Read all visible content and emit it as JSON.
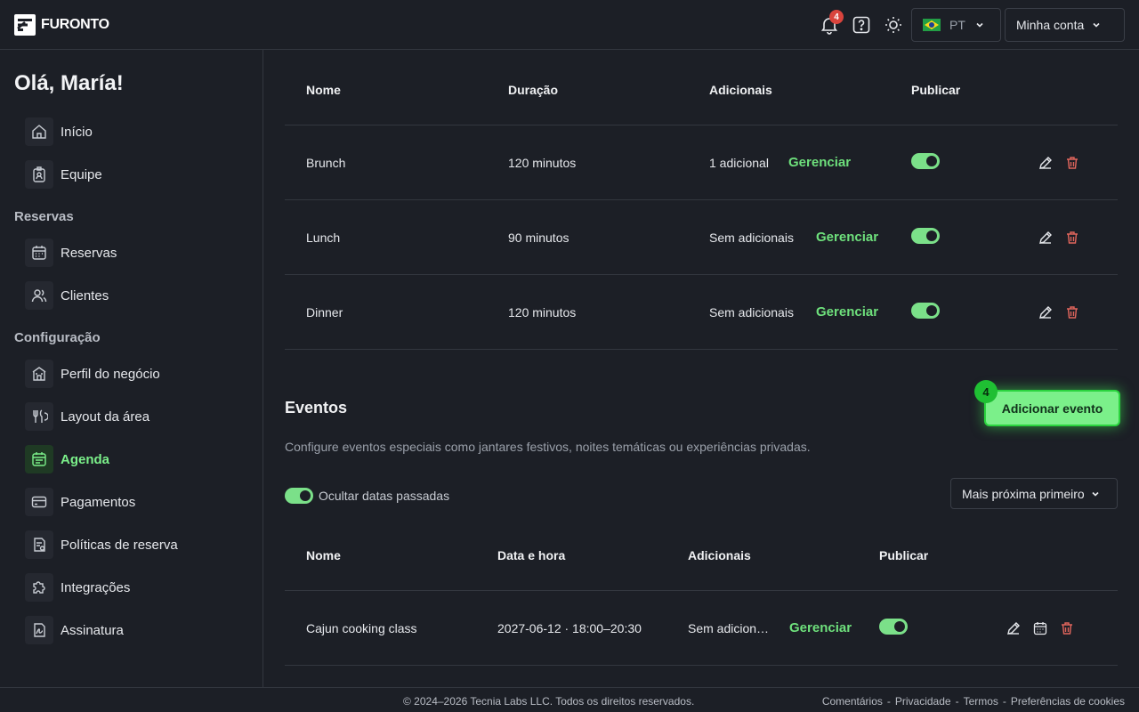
{
  "header": {
    "brand": "FURONTO",
    "notifications_count": "4",
    "language": "PT",
    "account_label": "Minha conta"
  },
  "sidebar": {
    "greeting": "Olá, María!",
    "items_top": [
      {
        "label": "Início",
        "icon": "home-icon"
      },
      {
        "label": "Equipe",
        "icon": "badge-icon"
      }
    ],
    "section_reservas": "Reservas",
    "items_reservas": [
      {
        "label": "Reservas",
        "icon": "calendar-icon"
      },
      {
        "label": "Clientes",
        "icon": "users-icon"
      }
    ],
    "section_config": "Configuração",
    "items_config": [
      {
        "label": "Perfil do negócio",
        "icon": "store-icon"
      },
      {
        "label": "Layout da área",
        "icon": "utensils-icon"
      },
      {
        "label": "Agenda",
        "icon": "schedule-icon",
        "active": true
      },
      {
        "label": "Pagamentos",
        "icon": "card-icon"
      },
      {
        "label": "Políticas de reserva",
        "icon": "policy-icon"
      },
      {
        "label": "Integrações",
        "icon": "puzzle-icon"
      },
      {
        "label": "Assinatura",
        "icon": "signature-icon"
      }
    ]
  },
  "services_table": {
    "headers": [
      "Nome",
      "Duração",
      "Adicionais",
      "Publicar"
    ],
    "rows": [
      {
        "name": "Brunch",
        "duration": "120 minutos",
        "addons": "1 adicional",
        "manage": "Gerenciar"
      },
      {
        "name": "Lunch",
        "duration": "90 minutos",
        "addons": "Sem adicionais",
        "manage": "Gerenciar"
      },
      {
        "name": "Dinner",
        "duration": "120 minutos",
        "addons": "Sem adicionais",
        "manage": "Gerenciar"
      }
    ]
  },
  "events": {
    "title": "Eventos",
    "description": "Configure eventos especiais como jantares festivos, noites temáticas ou experiências privadas.",
    "add_button": "Adicionar evento",
    "add_badge": "4",
    "hide_past_label": "Ocultar datas passadas",
    "sort_label": "Mais próxima primeiro",
    "headers": [
      "Nome",
      "Data e hora",
      "Adicionais",
      "Publicar"
    ],
    "rows": [
      {
        "name": "Cajun cooking class",
        "datetime": "2027-06-12 · 18:00–20:30",
        "addons": "Sem adicion…",
        "manage": "Gerenciar"
      }
    ]
  },
  "footer": {
    "copyright": "© 2024–2026 Tecnia Labs LLC. Todos os direitos reservados.",
    "links": [
      "Comentários",
      "Privacidade",
      "Termos",
      "Preferências de cookies"
    ],
    "separator": "-"
  },
  "colors": {
    "background": "#1c1f26",
    "accent": "#7bf08a",
    "danger": "#e0655c"
  }
}
